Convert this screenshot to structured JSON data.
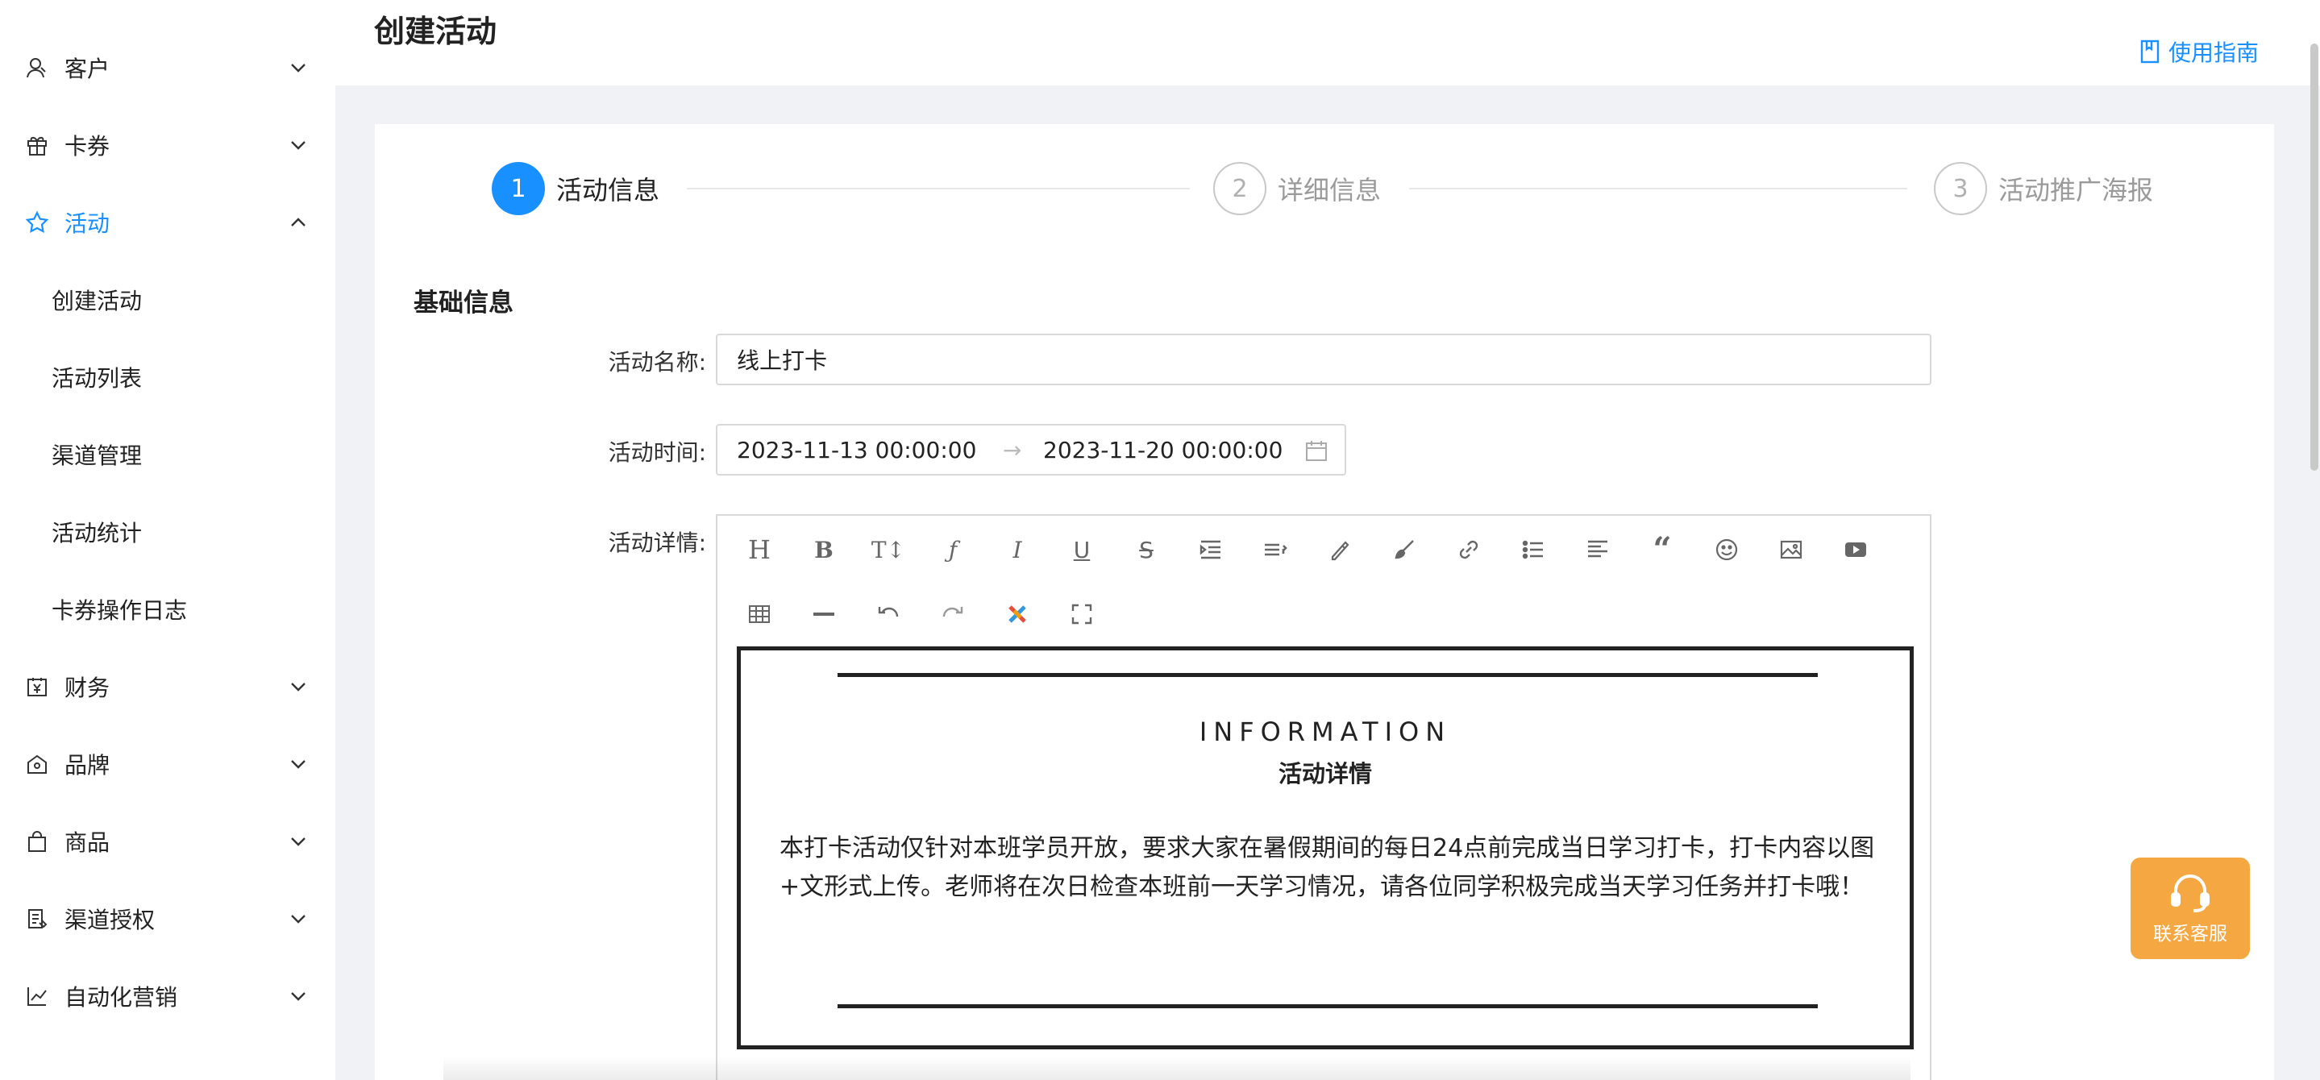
{
  "sidebar": {
    "items": [
      {
        "label": "客户",
        "icon": "user-icon"
      },
      {
        "label": "卡券",
        "icon": "gift-icon"
      },
      {
        "label": "活动",
        "icon": "star-icon",
        "active": true
      },
      {
        "label": "财务",
        "icon": "finance-icon"
      },
      {
        "label": "品牌",
        "icon": "brand-icon"
      },
      {
        "label": "商品",
        "icon": "bag-icon"
      },
      {
        "label": "渠道授权",
        "icon": "document-icon"
      },
      {
        "label": "自动化营销",
        "icon": "chart-icon"
      }
    ],
    "sub_items": [
      "创建活动",
      "活动列表",
      "渠道管理",
      "活动统计",
      "卡券操作日志"
    ]
  },
  "header": {
    "title": "创建活动",
    "guide_link": "使用指南"
  },
  "steps": [
    {
      "number": "1",
      "label": "活动信息",
      "state": "active"
    },
    {
      "number": "2",
      "label": "详细信息",
      "state": "todo"
    },
    {
      "number": "3",
      "label": "活动推广海报",
      "state": "todo"
    }
  ],
  "form": {
    "section_title": "基础信息",
    "name_label": "活动名称:",
    "name_value": "线上打卡",
    "time_label": "活动时间:",
    "start_time": "2023-11-13 00:00:00",
    "end_time": "2023-11-20 00:00:00",
    "detail_label": "活动详情:"
  },
  "editor": {
    "toolbar": [
      "heading",
      "bold",
      "font-size",
      "font-family",
      "italic",
      "underline",
      "strikethrough",
      "indent",
      "line-height",
      "font-color",
      "background-color",
      "link",
      "bulleted-list",
      "align",
      "quote",
      "emoji",
      "image",
      "video",
      "table",
      "divider",
      "undo",
      "redo",
      "clear-format",
      "fullscreen"
    ],
    "content": {
      "heading_en": "INFORMATION",
      "heading_zh": "活动详情",
      "body": "本打卡活动仅针对本班学员开放，要求大家在暑假期间的每日24点前完成当日学习打卡，打卡内容以图+文形式上传。老师将在次日检查本班前一天学习情况，请各位同学积极完成当天学习任务并打卡哦！"
    }
  },
  "service": {
    "label": "联系客服"
  },
  "colors": {
    "accent": "#1890ff",
    "service": "#f5a742",
    "page_bg": "#f0f2f5"
  }
}
